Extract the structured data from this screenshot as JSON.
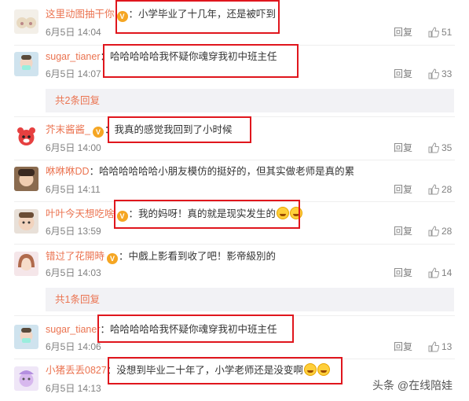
{
  "ui": {
    "reply_label": "回复",
    "watermark": "头条 @在线陪娃"
  },
  "comments": [
    {
      "user": "这里动图抽干你",
      "has_badge": true,
      "text": "：小学毕业了十几年，还是被吓到",
      "date": "6月5日 14:04",
      "likes": "51",
      "emoji_count": 0
    },
    {
      "user": "sugar_tianer",
      "has_badge": false,
      "text": "：哈哈哈哈哈我怀疑你魂穿我初中班主任",
      "date": "6月5日 14:07",
      "likes": "33",
      "emoji_count": 0
    },
    {
      "user": "芥末酱酱_",
      "has_badge": true,
      "text": "：我真的感觉我回到了小时候",
      "date": "6月5日 14:00",
      "likes": "35",
      "emoji_count": 0
    },
    {
      "user": "咻咻咻DD",
      "has_badge": false,
      "text": "：哈哈哈哈哈哈小朋友模仿的挺好的，但其实做老师是真的累",
      "date": "6月5日 14:11",
      "likes": "28",
      "emoji_count": 0
    },
    {
      "user": "叶叶今天想吃啥",
      "has_badge": true,
      "text": "：我的妈呀！真的就是现实发生的",
      "date": "6月5日 13:59",
      "likes": "28",
      "emoji_count": 2
    },
    {
      "user": "错过了花開時",
      "has_badge": true,
      "text": "：中戲上影看到收了吧！影帝級別的",
      "date": "6月5日 14:03",
      "likes": "14",
      "emoji_count": 0
    },
    {
      "user": "sugar_tianer",
      "has_badge": false,
      "text": "：哈哈哈哈哈我怀疑你魂穿我初中班主任",
      "date": "6月5日 14:06",
      "likes": "13",
      "emoji_count": 0
    },
    {
      "user": "小猪丢丢0827",
      "has_badge": false,
      "text": "：没想到毕业二十年了，小学老师还是没变啊",
      "date": "6月5日 14:13",
      "likes": "",
      "emoji_count": 2
    }
  ],
  "more_replies": [
    {
      "label": "共2条回复"
    },
    {
      "label": "共1条回复"
    }
  ],
  "colors": {
    "username": "#eb7350",
    "highlight_box": "#e0161d",
    "meta": "#808080"
  }
}
